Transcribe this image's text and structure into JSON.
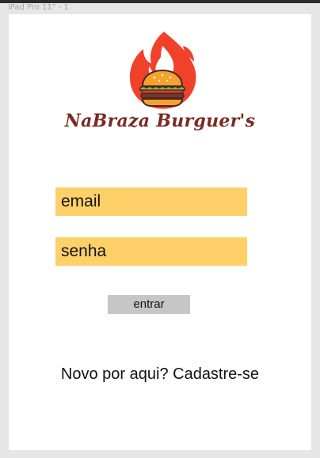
{
  "canvas": {
    "frame_label": "iPad Pro 11\" - 1"
  },
  "brand": {
    "name": "NaBraza Burguer's",
    "logo_icon": "burger-flame-icon",
    "colors": {
      "flame": "#f0412b",
      "flame_light": "#f5762c",
      "name": "#7a2a22"
    }
  },
  "login": {
    "email_placeholder": "email",
    "password_placeholder": "senha",
    "submit_label": "entrar",
    "signup_label": "Novo por aqui? Cadastre-se",
    "colors": {
      "field_background": "#fed06a",
      "button_background": "#c6c6c6"
    }
  }
}
